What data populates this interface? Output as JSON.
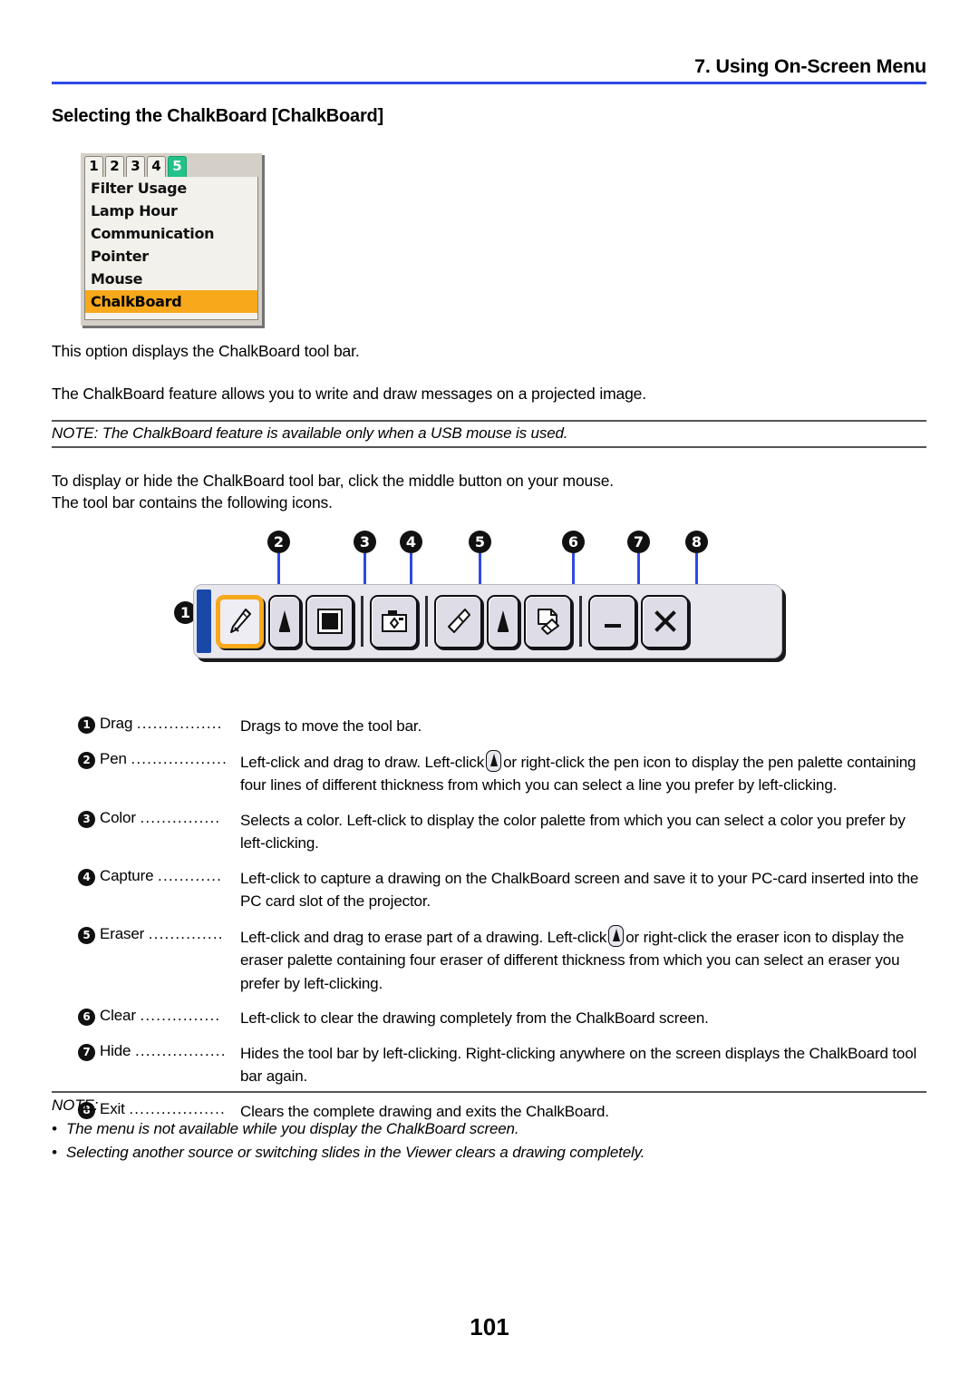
{
  "header": {
    "title": "7. Using On-Screen Menu",
    "rule_color": "#2f49e8"
  },
  "section": {
    "title": "Selecting the ChalkBoard [ChalkBoard]"
  },
  "osd_menu": {
    "tabs": [
      {
        "label": "1",
        "active": false
      },
      {
        "label": "2",
        "active": false
      },
      {
        "label": "3",
        "active": false
      },
      {
        "label": "4",
        "active": false
      },
      {
        "label": "5",
        "active": true
      }
    ],
    "active_tab_color": "#22c289",
    "selected_item_color": "#f7a81b",
    "items": [
      {
        "label": "Filter Usage",
        "selected": false
      },
      {
        "label": "Lamp Hour",
        "selected": false
      },
      {
        "label": "Communication",
        "selected": false
      },
      {
        "label": "Pointer",
        "selected": false
      },
      {
        "label": "Mouse",
        "selected": false
      },
      {
        "label": "ChalkBoard",
        "selected": true
      }
    ]
  },
  "body": {
    "para1": "This option displays the ChalkBoard tool bar.",
    "para2": "The ChalkBoard feature allows you to write and draw messages on a projected image.",
    "note1": "NOTE: The ChalkBoard feature is available only when a USB mouse is used.",
    "para4": "To display or hide the ChalkBoard tool bar, click the middle button on your mouse.",
    "para5": "The tool bar contains the following icons."
  },
  "figure": {
    "callouts": [
      "1",
      "2",
      "3",
      "4",
      "5",
      "6",
      "7",
      "8"
    ],
    "leader_color": "#2f49e8",
    "grip_color": "#1948a8",
    "active_button_color": "#f7a81b",
    "buttons": [
      {
        "icon": "pen-icon",
        "active": true
      },
      {
        "icon": "pen-thickness-icon",
        "active": false
      },
      {
        "icon": "color-swatch-icon",
        "active": false
      },
      {
        "icon": "camera-capture-icon",
        "active": false
      },
      {
        "icon": "eraser-icon",
        "active": false
      },
      {
        "icon": "eraser-thickness-icon",
        "active": false
      },
      {
        "icon": "clear-page-icon",
        "active": false
      },
      {
        "icon": "minimize-icon",
        "active": false
      },
      {
        "icon": "close-icon",
        "active": false
      }
    ]
  },
  "definitions": [
    {
      "num": "1",
      "term": "Drag",
      "dots": "................",
      "desc_pre": "Drags to move the tool bar.",
      "has_icon": false,
      "desc_post": ""
    },
    {
      "num": "2",
      "term": "Pen",
      "dots": "..................",
      "desc_pre": "Left-click and drag to draw. Left-click",
      "has_icon": true,
      "icon_name": "pen-thickness-icon",
      "desc_post": "or right-click the pen icon to display the pen palette containing four lines of different thickness from which you can select a line you prefer by left-clicking."
    },
    {
      "num": "3",
      "term": "Color",
      "dots": "...............",
      "desc_pre": "Selects a color. Left-click to display the color palette from which you can select a color you prefer by left-clicking.",
      "has_icon": false,
      "desc_post": ""
    },
    {
      "num": "4",
      "term": "Capture",
      "dots": "............",
      "desc_pre": "Left-click to capture a drawing on the ChalkBoard screen and save it to your PC-card inserted into the PC card slot of the projector.",
      "has_icon": false,
      "desc_post": ""
    },
    {
      "num": "5",
      "term": "Eraser",
      "dots": "..............",
      "desc_pre": "Left-click and drag to erase part of a drawing. Left-click",
      "has_icon": true,
      "icon_name": "eraser-thickness-icon",
      "desc_post": "or right-click the eraser icon to display the eraser palette containing four eraser of different thickness from which you can select an eraser you prefer by left-clicking."
    },
    {
      "num": "6",
      "term": "Clear",
      "dots": "...............",
      "desc_pre": "Left-click to clear the drawing completely from the ChalkBoard screen.",
      "has_icon": false,
      "desc_post": ""
    },
    {
      "num": "7",
      "term": "Hide",
      "dots": ".................",
      "desc_pre": "Hides the tool bar by left-clicking. Right-clicking anywhere on the screen displays the ChalkBoard tool bar again.",
      "has_icon": false,
      "desc_post": ""
    },
    {
      "num": "8",
      "term": "Exit",
      "dots": "..................",
      "desc_pre": "Clears the complete drawing and exits the ChalkBoard.",
      "has_icon": false,
      "desc_post": ""
    }
  ],
  "note_bottom": {
    "heading": "NOTE:",
    "items": [
      "The menu is not available while you display the ChalkBoard screen.",
      "Selecting another source or switching slides in the Viewer clears a drawing completely."
    ]
  },
  "page_number": "101"
}
